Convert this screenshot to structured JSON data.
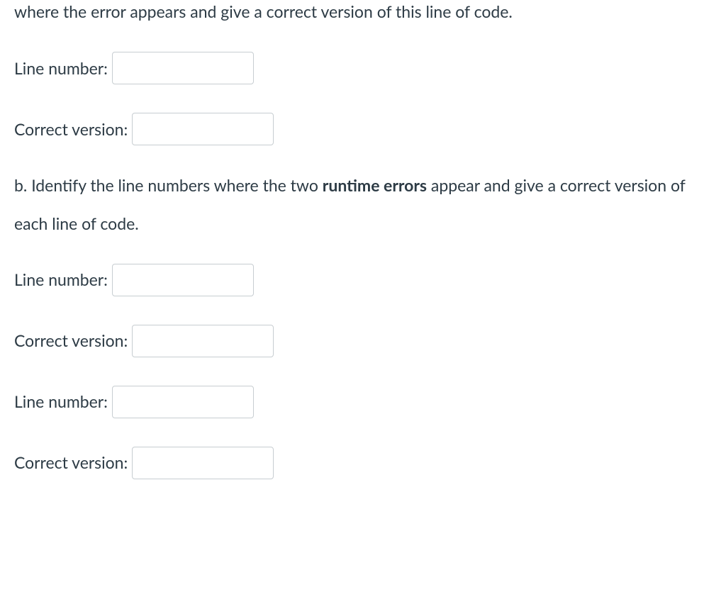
{
  "intro_fragment": "where the error appears and give a correct version of this line of code.",
  "labels": {
    "line_number": "Line number:",
    "correct_version": "Correct version:"
  },
  "part_b": {
    "pre": "b. Identify the line numbers where the two ",
    "bold": "runtime errors",
    "post": " appear and give a correct version of",
    "line2": "each line of code."
  },
  "inputs": {
    "a_line": "",
    "a_version": "",
    "b_line_1": "",
    "b_version_1": "",
    "b_line_2": "",
    "b_version_2": ""
  }
}
